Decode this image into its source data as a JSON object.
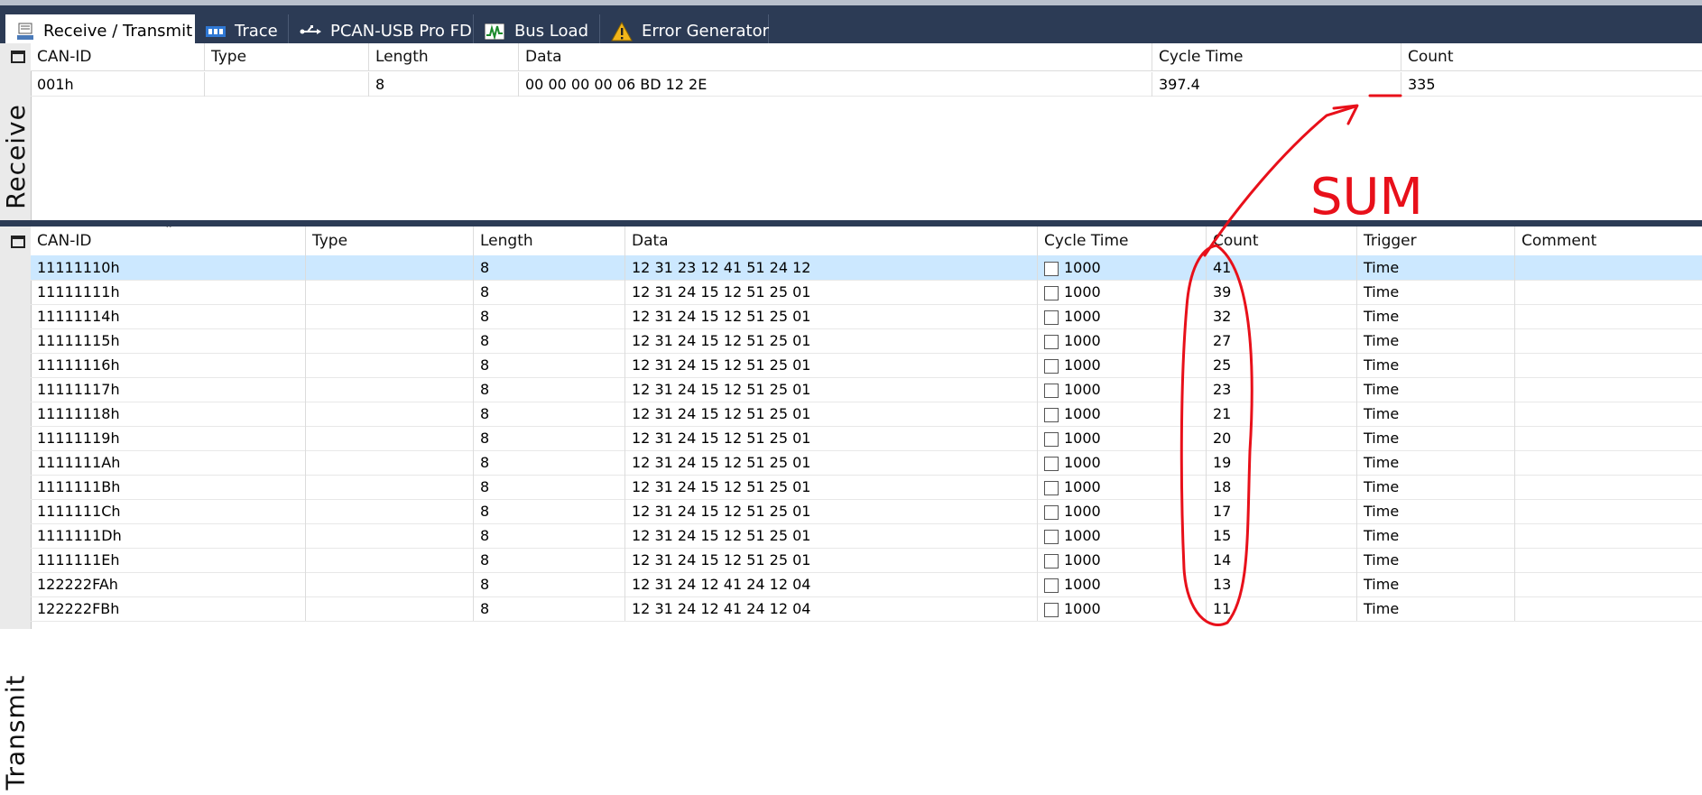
{
  "tabs": [
    {
      "label": "Receive / Transmit",
      "icon": "receive-transmit-icon",
      "active": true
    },
    {
      "label": "Trace",
      "icon": "trace-icon"
    },
    {
      "label": "PCAN-USB Pro FD",
      "icon": "usb-icon"
    },
    {
      "label": "Bus Load",
      "icon": "bus-load-icon"
    },
    {
      "label": "Error Generator",
      "icon": "warning-icon"
    }
  ],
  "receive": {
    "panel_label": "Receive",
    "headers": [
      "CAN-ID",
      "Type",
      "Length",
      "Data",
      "Cycle Time",
      "Count"
    ],
    "rows": [
      {
        "can_id": "001h",
        "type": "",
        "length": "8",
        "data": "00 00 00 00 06 BD 12 2E",
        "cycle_time": "397.4",
        "count": "335"
      }
    ]
  },
  "transmit": {
    "panel_label": "Transmit",
    "headers": [
      "CAN-ID",
      "Type",
      "Length",
      "Data",
      "Cycle Time",
      "Count",
      "Trigger",
      "Comment"
    ],
    "rows": [
      {
        "can_id": "11111110h",
        "type": "",
        "length": "8",
        "data": "12 31 23 12 41 51 24 12",
        "cycle_time": "1000",
        "count": "41",
        "trigger": "Time",
        "comment": ""
      },
      {
        "can_id": "11111111h",
        "type": "",
        "length": "8",
        "data": "12 31 24 15 12 51 25 01",
        "cycle_time": "1000",
        "count": "39",
        "trigger": "Time",
        "comment": ""
      },
      {
        "can_id": "11111114h",
        "type": "",
        "length": "8",
        "data": "12 31 24 15 12 51 25 01",
        "cycle_time": "1000",
        "count": "32",
        "trigger": "Time",
        "comment": ""
      },
      {
        "can_id": "11111115h",
        "type": "",
        "length": "8",
        "data": "12 31 24 15 12 51 25 01",
        "cycle_time": "1000",
        "count": "27",
        "trigger": "Time",
        "comment": ""
      },
      {
        "can_id": "11111116h",
        "type": "",
        "length": "8",
        "data": "12 31 24 15 12 51 25 01",
        "cycle_time": "1000",
        "count": "25",
        "trigger": "Time",
        "comment": ""
      },
      {
        "can_id": "11111117h",
        "type": "",
        "length": "8",
        "data": "12 31 24 15 12 51 25 01",
        "cycle_time": "1000",
        "count": "23",
        "trigger": "Time",
        "comment": ""
      },
      {
        "can_id": "11111118h",
        "type": "",
        "length": "8",
        "data": "12 31 24 15 12 51 25 01",
        "cycle_time": "1000",
        "count": "21",
        "trigger": "Time",
        "comment": ""
      },
      {
        "can_id": "11111119h",
        "type": "",
        "length": "8",
        "data": "12 31 24 15 12 51 25 01",
        "cycle_time": "1000",
        "count": "20",
        "trigger": "Time",
        "comment": ""
      },
      {
        "can_id": "1111111Ah",
        "type": "",
        "length": "8",
        "data": "12 31 24 15 12 51 25 01",
        "cycle_time": "1000",
        "count": "19",
        "trigger": "Time",
        "comment": ""
      },
      {
        "can_id": "1111111Bh",
        "type": "",
        "length": "8",
        "data": "12 31 24 15 12 51 25 01",
        "cycle_time": "1000",
        "count": "18",
        "trigger": "Time",
        "comment": ""
      },
      {
        "can_id": "1111111Ch",
        "type": "",
        "length": "8",
        "data": "12 31 24 15 12 51 25 01",
        "cycle_time": "1000",
        "count": "17",
        "trigger": "Time",
        "comment": ""
      },
      {
        "can_id": "1111111Dh",
        "type": "",
        "length": "8",
        "data": "12 31 24 15 12 51 25 01",
        "cycle_time": "1000",
        "count": "15",
        "trigger": "Time",
        "comment": ""
      },
      {
        "can_id": "1111111Eh",
        "type": "",
        "length": "8",
        "data": "12 31 24 15 12 51 25 01",
        "cycle_time": "1000",
        "count": "14",
        "trigger": "Time",
        "comment": ""
      },
      {
        "can_id": "122222FAh",
        "type": "",
        "length": "8",
        "data": "12 31 24 12 41 24 12 04",
        "cycle_time": "1000",
        "count": "13",
        "trigger": "Time",
        "comment": ""
      },
      {
        "can_id": "122222FBh",
        "type": "",
        "length": "8",
        "data": "12 31 24 12 41 24 12 04",
        "cycle_time": "1000",
        "count": "11",
        "trigger": "Time",
        "comment": ""
      }
    ]
  },
  "annotation": {
    "text": "SUM",
    "color": "#e8101a"
  },
  "colors": {
    "tabbar": "#2c3b55",
    "selected_row": "#cce8ff",
    "annotation": "#e8101a"
  }
}
